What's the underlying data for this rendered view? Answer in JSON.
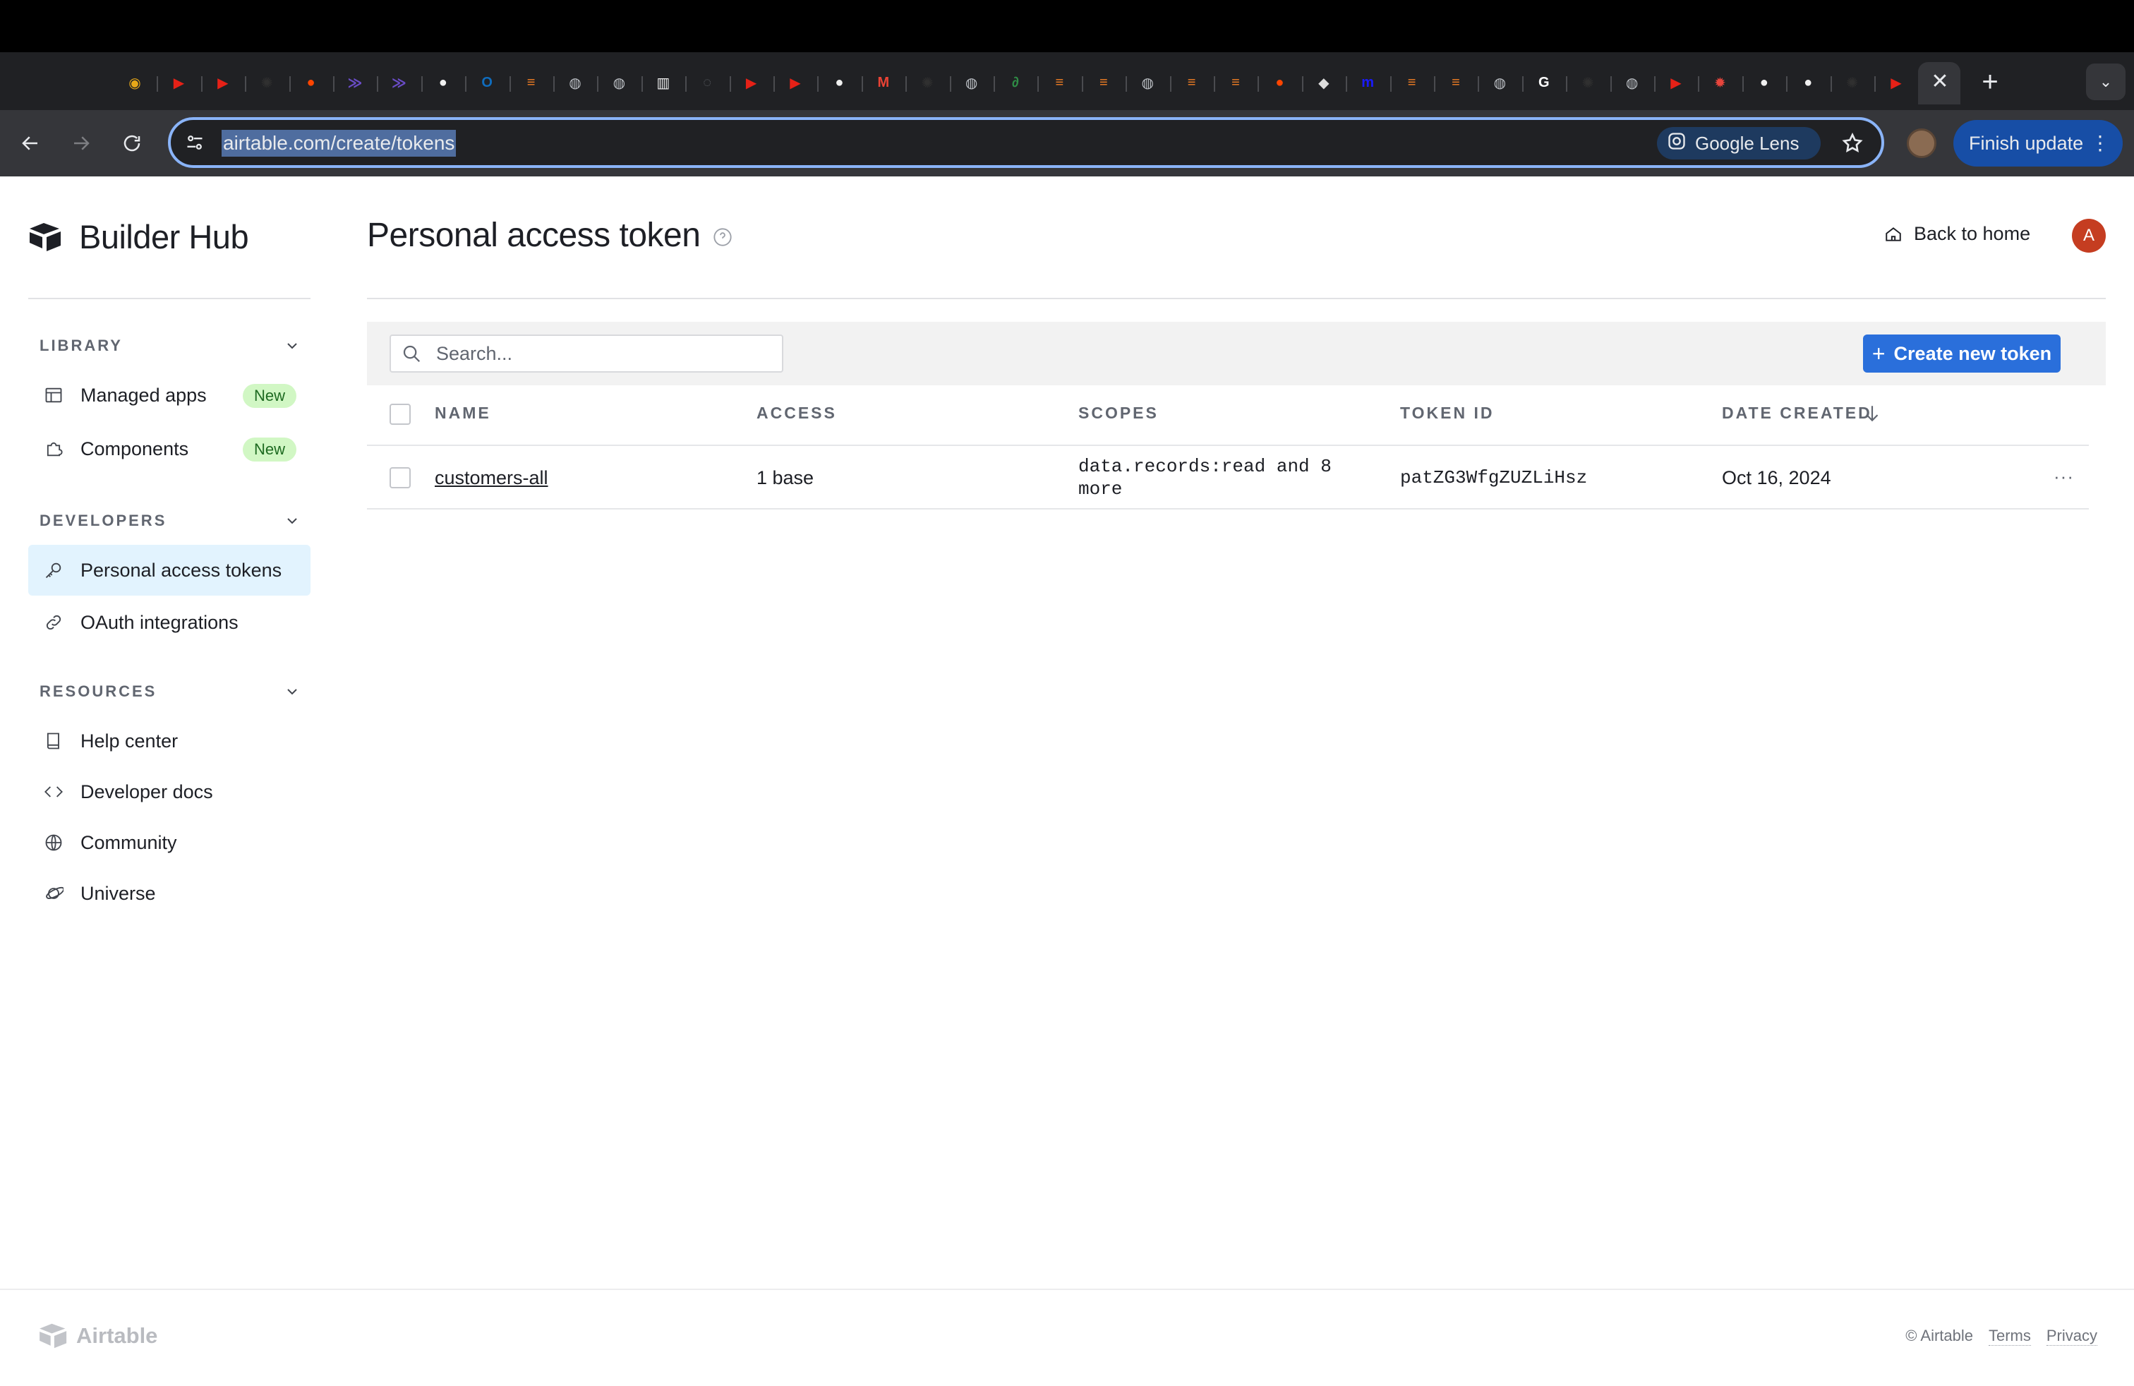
{
  "browser": {
    "url": "airtable.com/create/tokens",
    "lens_label": "Google Lens",
    "update_label": "Finish update",
    "tabs": [
      {
        "icon": "chrome-multicolor-icon",
        "glyph": "◉",
        "color": "#e8a818"
      },
      {
        "icon": "youtube-icon",
        "glyph": "▶",
        "color": "#e62117"
      },
      {
        "icon": "youtube-icon",
        "glyph": "▶",
        "color": "#e62117"
      },
      {
        "icon": "openai-icon",
        "glyph": "✺",
        "color": "#303030"
      },
      {
        "icon": "reddit-icon",
        "glyph": "●",
        "color": "#ff4500"
      },
      {
        "icon": "frame-icon",
        "glyph": "≫",
        "color": "#6a4cc7"
      },
      {
        "icon": "frame-icon",
        "glyph": "≫",
        "color": "#6a4cc7"
      },
      {
        "icon": "github-icon",
        "glyph": "●",
        "color": "#f0f0f0"
      },
      {
        "icon": "outlook-icon",
        "glyph": "O",
        "color": "#0f6cbd"
      },
      {
        "icon": "stackoverflow-icon",
        "glyph": "≡",
        "color": "#f48024"
      },
      {
        "icon": "globe-icon",
        "glyph": "◍",
        "color": "#bdc1c6"
      },
      {
        "icon": "globe-icon",
        "glyph": "◍",
        "color": "#bdc1c6"
      },
      {
        "icon": "notes-icon",
        "glyph": "▥",
        "color": "#f0f0f0"
      },
      {
        "icon": "loading-icon",
        "glyph": "◌",
        "color": "#5f6368"
      },
      {
        "icon": "youtube-icon",
        "glyph": "▶",
        "color": "#e62117"
      },
      {
        "icon": "youtube-icon",
        "glyph": "▶",
        "color": "#e62117"
      },
      {
        "icon": "github-icon",
        "glyph": "●",
        "color": "#f0f0f0"
      },
      {
        "icon": "gmail-icon",
        "glyph": "M",
        "color": "#ea4335"
      },
      {
        "icon": "openai-icon",
        "glyph": "✺",
        "color": "#303030"
      },
      {
        "icon": "globe-icon",
        "glyph": "◍",
        "color": "#bdc1c6"
      },
      {
        "icon": "geeksforgeeks-icon",
        "glyph": "∂",
        "color": "#2f8d46"
      },
      {
        "icon": "stackoverflow-icon",
        "glyph": "≡",
        "color": "#f48024"
      },
      {
        "icon": "stackoverflow-icon",
        "glyph": "≡",
        "color": "#f48024"
      },
      {
        "icon": "globe-icon",
        "glyph": "◍",
        "color": "#bdc1c6"
      },
      {
        "icon": "stackoverflow-icon",
        "glyph": "≡",
        "color": "#f48024"
      },
      {
        "icon": "stackoverflow-icon",
        "glyph": "≡",
        "color": "#f48024"
      },
      {
        "icon": "reddit-icon",
        "glyph": "●",
        "color": "#ff4500"
      },
      {
        "icon": "car-icon",
        "glyph": "◆",
        "color": "#dcdcdc"
      },
      {
        "icon": "medium-icon",
        "glyph": "m",
        "color": "#1a1aff"
      },
      {
        "icon": "stackoverflow-icon",
        "glyph": "≡",
        "color": "#f48024"
      },
      {
        "icon": "stackoverflow-icon",
        "glyph": "≡",
        "color": "#f48024"
      },
      {
        "icon": "globe-icon",
        "glyph": "◍",
        "color": "#bdc1c6"
      },
      {
        "icon": "google-icon",
        "glyph": "G",
        "color": "#ffffff"
      },
      {
        "icon": "openai-icon",
        "glyph": "✺",
        "color": "#303030"
      },
      {
        "icon": "globe-icon",
        "glyph": "◍",
        "color": "#bdc1c6"
      },
      {
        "icon": "youtube-icon",
        "glyph": "▶",
        "color": "#e62117"
      },
      {
        "icon": "settings-red-icon",
        "glyph": "✹",
        "color": "#e8453c"
      },
      {
        "icon": "github-icon",
        "glyph": "●",
        "color": "#f0f0f0"
      },
      {
        "icon": "github-icon",
        "glyph": "●",
        "color": "#f0f0f0"
      },
      {
        "icon": "openai-icon",
        "glyph": "✺",
        "color": "#303030"
      },
      {
        "icon": "youtube-icon",
        "glyph": "▶",
        "color": "#e62117"
      }
    ]
  },
  "brand": {
    "name": "Builder Hub"
  },
  "sidebar": {
    "sections": [
      {
        "title": "LIBRARY",
        "items": [
          {
            "label": "Managed apps",
            "badge": "New",
            "icon": "table-icon"
          },
          {
            "label": "Components",
            "badge": "New",
            "icon": "puzzle-icon"
          }
        ]
      },
      {
        "title": "DEVELOPERS",
        "items": [
          {
            "label": "Personal access tokens",
            "icon": "key-icon",
            "active": true
          },
          {
            "label": "OAuth integrations",
            "icon": "link-icon"
          }
        ]
      },
      {
        "title": "RESOURCES",
        "items": [
          {
            "label": "Help center",
            "icon": "book-icon"
          },
          {
            "label": "Developer docs",
            "icon": "code-icon"
          },
          {
            "label": "Community",
            "icon": "globe-icon"
          },
          {
            "label": "Universe",
            "icon": "planet-icon"
          }
        ]
      }
    ]
  },
  "header": {
    "title": "Personal access token",
    "back_label": "Back to home",
    "avatar_initial": "A"
  },
  "search": {
    "placeholder": "Search..."
  },
  "create_button": {
    "label": "Create new token"
  },
  "table": {
    "columns": [
      "NAME",
      "ACCESS",
      "SCOPES",
      "TOKEN ID",
      "DATE CREATED"
    ],
    "sort_column": "DATE CREATED",
    "rows": [
      {
        "name": "customers-all",
        "access": "1 base",
        "scopes_line1": "data.records:read and 8",
        "scopes_line2": "more",
        "token_id": "patZG3WfgZUZLiHsz",
        "date_created": "Oct 16, 2024"
      }
    ]
  },
  "footer": {
    "logo_text": "Airtable",
    "copyright": "© Airtable",
    "terms": "Terms",
    "privacy": "Privacy"
  },
  "colors": {
    "accent": "#2a6fdb",
    "active_nav_bg": "#e2f3fe",
    "badge_bg": "#d1f7c4",
    "avatar_bg": "#c53d21"
  }
}
